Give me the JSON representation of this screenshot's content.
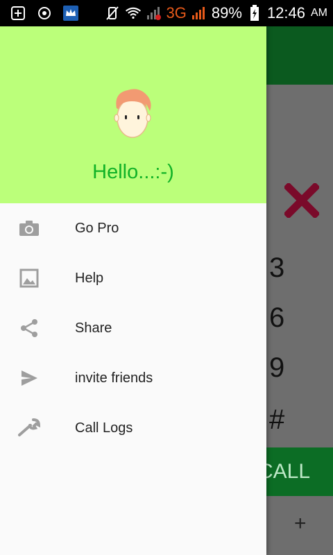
{
  "status_bar": {
    "network": "3G",
    "battery": "89%",
    "time": "12:46",
    "ampm": "AM"
  },
  "drawer": {
    "greeting": "Hello...:-)",
    "items": [
      {
        "label": "Go Pro",
        "icon": "camera-icon"
      },
      {
        "label": "Help",
        "icon": "image-icon"
      },
      {
        "label": "Share",
        "icon": "share-icon"
      },
      {
        "label": "invite friends",
        "icon": "send-icon"
      },
      {
        "label": "Call Logs",
        "icon": "wrench-icon"
      }
    ]
  },
  "background": {
    "keys": [
      "3",
      "6",
      "9",
      "#"
    ],
    "call_label": "CALL",
    "add_symbol": "+"
  },
  "colors": {
    "header_bg": "#bbff7a",
    "greeting": "#10b227",
    "toolbar": "#0b5a1f",
    "call_button": "#0c6d25",
    "close_icon": "#7a0a2a"
  }
}
